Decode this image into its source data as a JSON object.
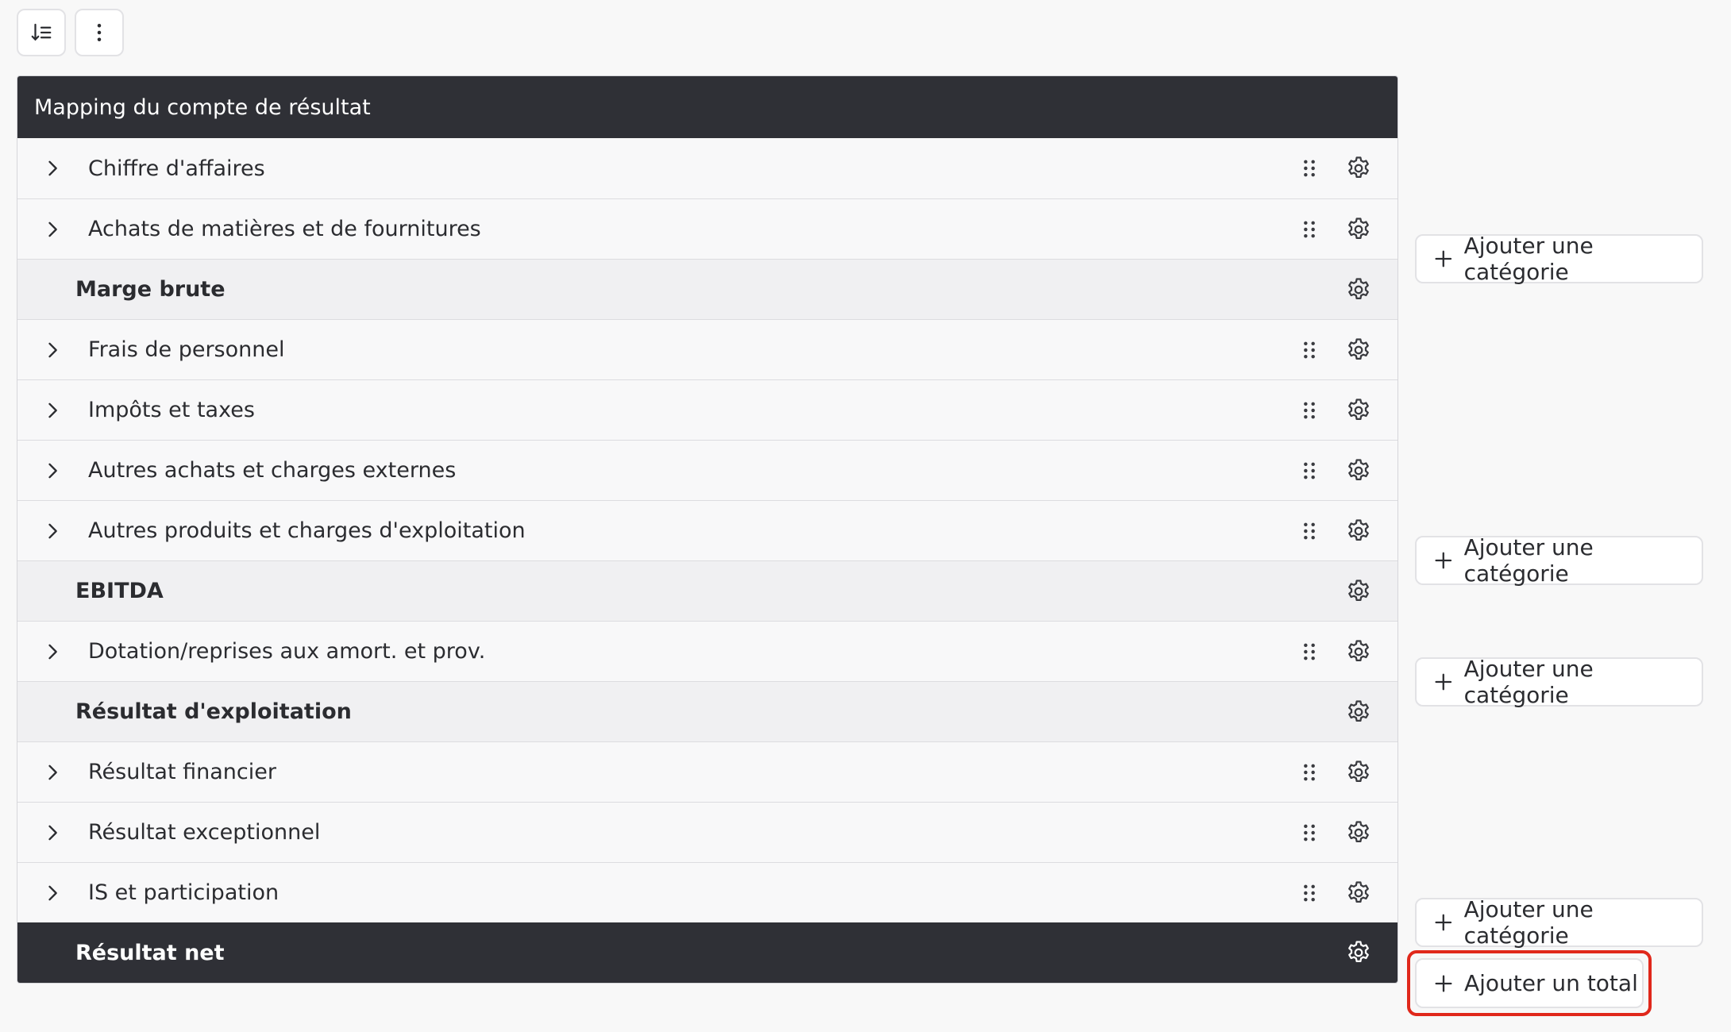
{
  "toolbar": {
    "sort_icon": "sort-icon",
    "more_icon": "more-vertical-icon"
  },
  "panel": {
    "title": "Mapping du compte de résultat"
  },
  "rows": [
    {
      "label": "Chiffre d'affaires",
      "kind": "category"
    },
    {
      "label": "Achats de matières et de fournitures",
      "kind": "category"
    },
    {
      "label": "Marge brute",
      "kind": "total"
    },
    {
      "label": "Frais de personnel",
      "kind": "category"
    },
    {
      "label": "Impôts et taxes",
      "kind": "category"
    },
    {
      "label": "Autres achats et charges externes",
      "kind": "category"
    },
    {
      "label": "Autres produits et charges d'exploitation",
      "kind": "category"
    },
    {
      "label": "EBITDA",
      "kind": "total"
    },
    {
      "label": "Dotation/reprises aux amort. et prov.",
      "kind": "category"
    },
    {
      "label": "Résultat d'exploitation",
      "kind": "total"
    },
    {
      "label": "Résultat financier",
      "kind": "category"
    },
    {
      "label": "Résultat exceptionnel",
      "kind": "category"
    },
    {
      "label": "IS et participation",
      "kind": "category"
    },
    {
      "label": "Résultat net",
      "kind": "final"
    }
  ],
  "actions": {
    "add_category": "Ajouter une catégorie",
    "add_total": "Ajouter un total"
  },
  "colors": {
    "header_bg": "#2f3036",
    "highlight": "#e0281b"
  }
}
